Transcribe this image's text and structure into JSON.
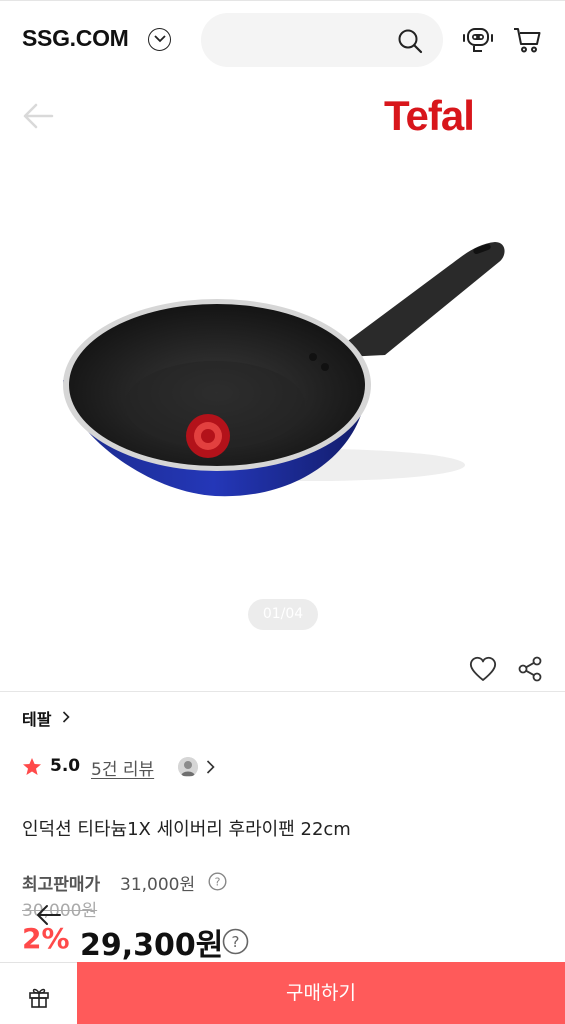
{
  "header": {
    "logo": "SSG.COM",
    "search_placeholder": ""
  },
  "gallery": {
    "brand_logo": "Tefal",
    "counter": "01/04"
  },
  "product": {
    "brand": "테팔",
    "rating": "5.0",
    "review_link": "5건 리뷰",
    "name": "인덕션 티타늄1X 세이버리 후라이팬 22cm",
    "highest_price_label": "최고판매가",
    "highest_price_value": "31,000원",
    "original_price": "30,000원",
    "discount_rate": "2%",
    "sale_price": "29,300원"
  },
  "bottom_bar": {
    "buy_label": "구매하기"
  },
  "colors": {
    "accent": "#ff5a5a",
    "brand_red": "#d8161b",
    "discount": "#ff4a4a"
  },
  "icons": [
    "chevron-down-icon",
    "search-icon",
    "chatbot-icon",
    "cart-icon",
    "back-arrow-icon",
    "heart-icon",
    "share-icon",
    "chevron-right-icon",
    "star-icon",
    "help-icon",
    "gift-icon"
  ]
}
